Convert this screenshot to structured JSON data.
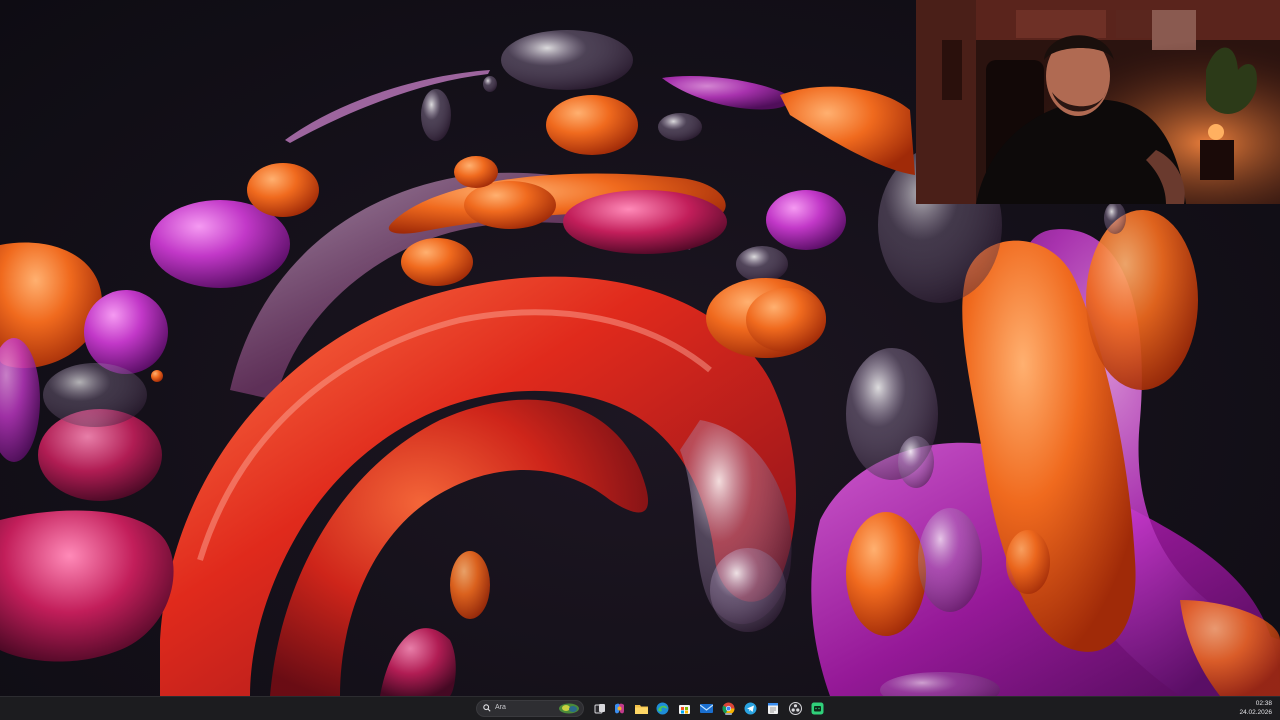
{
  "wallpaper": {
    "name": "Windows 11 bloom abstract"
  },
  "webcam": {
    "subject": "streamer-webcam"
  },
  "taskbar": {
    "search": {
      "placeholder": "Ara"
    },
    "apps": [
      {
        "name": "task-view",
        "icon": "task-view-icon"
      },
      {
        "name": "copilot",
        "icon": "copilot-icon"
      },
      {
        "name": "file-explorer",
        "icon": "folder-icon"
      },
      {
        "name": "edge",
        "icon": "edge-icon"
      },
      {
        "name": "microsoft-store",
        "icon": "store-icon"
      },
      {
        "name": "mail",
        "icon": "mail-icon"
      },
      {
        "name": "chrome",
        "icon": "chrome-icon",
        "active": true
      },
      {
        "name": "telegram",
        "icon": "telegram-icon"
      },
      {
        "name": "notepad",
        "icon": "notepad-icon"
      },
      {
        "name": "obs-studio",
        "icon": "obs-icon"
      },
      {
        "name": "android-app",
        "icon": "android-icon"
      }
    ],
    "clock": {
      "time": "02:38",
      "date": "24.02.2026"
    }
  },
  "colors": {
    "accent": "#0a74d8",
    "taskbar_bg": "#1c1c1f",
    "desktop_bg": "#141019"
  }
}
